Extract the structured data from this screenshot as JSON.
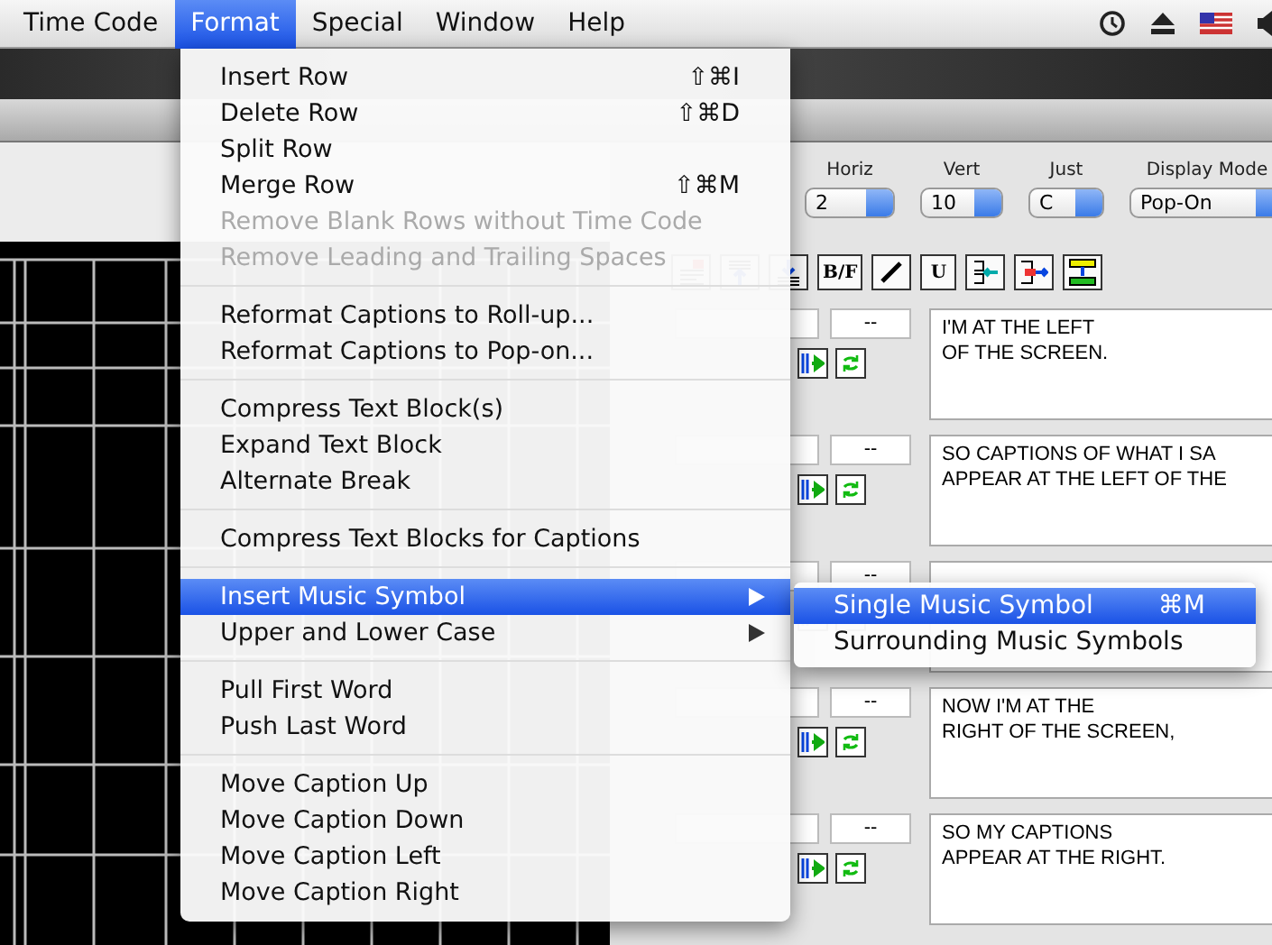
{
  "menu_bar": {
    "items": [
      {
        "label": "Time Code",
        "selected": false
      },
      {
        "label": "Format",
        "selected": true
      },
      {
        "label": "Special",
        "selected": false
      },
      {
        "label": "Window",
        "selected": false
      },
      {
        "label": "Help",
        "selected": false
      }
    ]
  },
  "settings": [
    {
      "label": "Horiz",
      "value": "2"
    },
    {
      "label": "Vert",
      "value": "10"
    },
    {
      "label": "Just",
      "value": "C"
    },
    {
      "label": "Display Mode",
      "value": "Pop-On"
    }
  ],
  "toolbar": [
    {
      "kind": "align-right"
    },
    {
      "kind": "text-up"
    },
    {
      "kind": "text-down"
    },
    {
      "kind": "text",
      "label": "B/F"
    },
    {
      "kind": "italic"
    },
    {
      "kind": "text",
      "label": "U"
    },
    {
      "kind": "merge-left"
    },
    {
      "kind": "merge-right"
    },
    {
      "kind": "stack"
    }
  ],
  "captions": [
    {
      "duration": "--",
      "lines": [
        "I'M AT THE LEFT",
        "OF THE SCREEN."
      ]
    },
    {
      "duration": "--",
      "lines": [
        "SO CAPTIONS OF WHAT I SA",
        "APPEAR AT THE LEFT OF THE"
      ]
    },
    {
      "duration": "--"
    },
    {
      "duration": "--",
      "lines": [
        "NOW I'M AT THE",
        "RIGHT OF THE SCREEN,"
      ]
    },
    {
      "duration": "--",
      "lines": [
        "SO MY CAPTIONS",
        "APPEAR AT THE RIGHT."
      ]
    }
  ],
  "format_menu": [
    {
      "kind": "item",
      "label": "Insert Row",
      "shortcut": "⇧⌘I",
      "disabled": false,
      "selected": false
    },
    {
      "kind": "item",
      "label": "Delete Row",
      "shortcut": "⇧⌘D",
      "disabled": false,
      "selected": false
    },
    {
      "kind": "item",
      "label": "Split Row",
      "disabled": false,
      "selected": false
    },
    {
      "kind": "item",
      "label": "Merge Row",
      "shortcut": "⇧⌘M",
      "disabled": false,
      "selected": false
    },
    {
      "kind": "item",
      "label": "Remove Blank Rows without Time Code",
      "disabled": true,
      "selected": false
    },
    {
      "kind": "item",
      "label": "Remove Leading and Trailing Spaces",
      "disabled": true,
      "selected": false
    },
    {
      "kind": "separator"
    },
    {
      "kind": "item",
      "label": "Reformat Captions to Roll-up...",
      "disabled": false,
      "selected": false
    },
    {
      "kind": "item",
      "label": "Reformat Captions to Pop-on...",
      "disabled": false,
      "selected": false
    },
    {
      "kind": "separator"
    },
    {
      "kind": "item",
      "label": "Compress Text Block(s)",
      "disabled": false,
      "selected": false
    },
    {
      "kind": "item",
      "label": "Expand Text Block",
      "disabled": false,
      "selected": false
    },
    {
      "kind": "item",
      "label": "Alternate Break",
      "disabled": false,
      "selected": false
    },
    {
      "kind": "separator"
    },
    {
      "kind": "item",
      "label": "Compress Text Blocks for Captions",
      "disabled": false,
      "selected": false
    },
    {
      "kind": "separator"
    },
    {
      "kind": "submenu",
      "label": "Insert Music Symbol",
      "disabled": false,
      "selected": true
    },
    {
      "kind": "submenu",
      "label": "Upper and Lower Case",
      "disabled": false,
      "selected": false
    },
    {
      "kind": "separator"
    },
    {
      "kind": "item",
      "label": "Pull First Word",
      "disabled": false,
      "selected": false
    },
    {
      "kind": "item",
      "label": "Push Last Word",
      "disabled": false,
      "selected": false
    },
    {
      "kind": "separator"
    },
    {
      "kind": "item",
      "label": "Move Caption Up",
      "disabled": false,
      "selected": false
    },
    {
      "kind": "item",
      "label": "Move Caption Down",
      "disabled": false,
      "selected": false
    },
    {
      "kind": "item",
      "label": "Move Caption Left",
      "disabled": false,
      "selected": false
    },
    {
      "kind": "item",
      "label": "Move Caption Right",
      "disabled": false,
      "selected": false
    }
  ],
  "submenu": [
    {
      "label": "Single Music Symbol",
      "shortcut": "⌘M",
      "selected": true
    },
    {
      "label": "Surrounding Music Symbols",
      "selected": false
    }
  ]
}
